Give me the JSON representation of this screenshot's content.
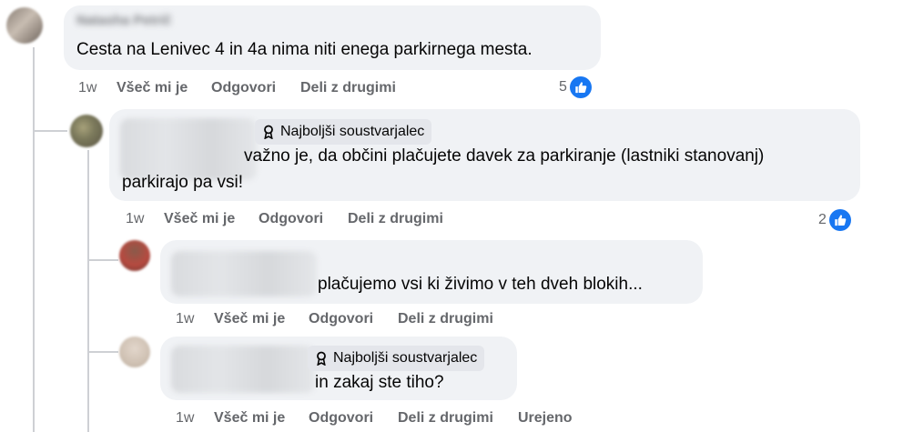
{
  "comments": [
    {
      "author": "Natasha Petrič",
      "text": "Cesta na Lenivec 4 in 4a nima niti enega parkirnega mesta.",
      "time": "1w",
      "like_label": "Všeč mi je",
      "reply_label": "Odgovori",
      "share_label": "Deli z drugimi",
      "reaction_count": "5"
    },
    {
      "badge": "Najboljši soustvarjalec",
      "text_line1": "važno je, da občini plačujete davek za parkiranje (lastniki stanovanj)",
      "text_line2": "parkirajo pa vsi!",
      "time": "1w",
      "like_label": "Všeč mi je",
      "reply_label": "Odgovori",
      "share_label": "Deli z drugimi",
      "reaction_count": "2"
    },
    {
      "text": "plačujemo vsi ki živimo v teh dveh blokih...",
      "time": "1w",
      "like_label": "Všeč mi je",
      "reply_label": "Odgovori",
      "share_label": "Deli z drugimi"
    },
    {
      "badge": "Najboljši soustvarjalec",
      "text": "in zakaj ste tiho?",
      "time": "1w",
      "like_label": "Všeč mi je",
      "reply_label": "Odgovori",
      "share_label": "Deli z drugimi",
      "edited_label": "Urejeno"
    }
  ],
  "colors": {
    "bubble": "#f0f2f5",
    "badge": "#e4e6eb",
    "meta_text": "#65676b",
    "like_blue": "#1877f2",
    "thread_line": "#ced0d4"
  },
  "icons": {
    "badge": "award-ribbon-icon",
    "reaction": "thumbs-up-icon"
  }
}
